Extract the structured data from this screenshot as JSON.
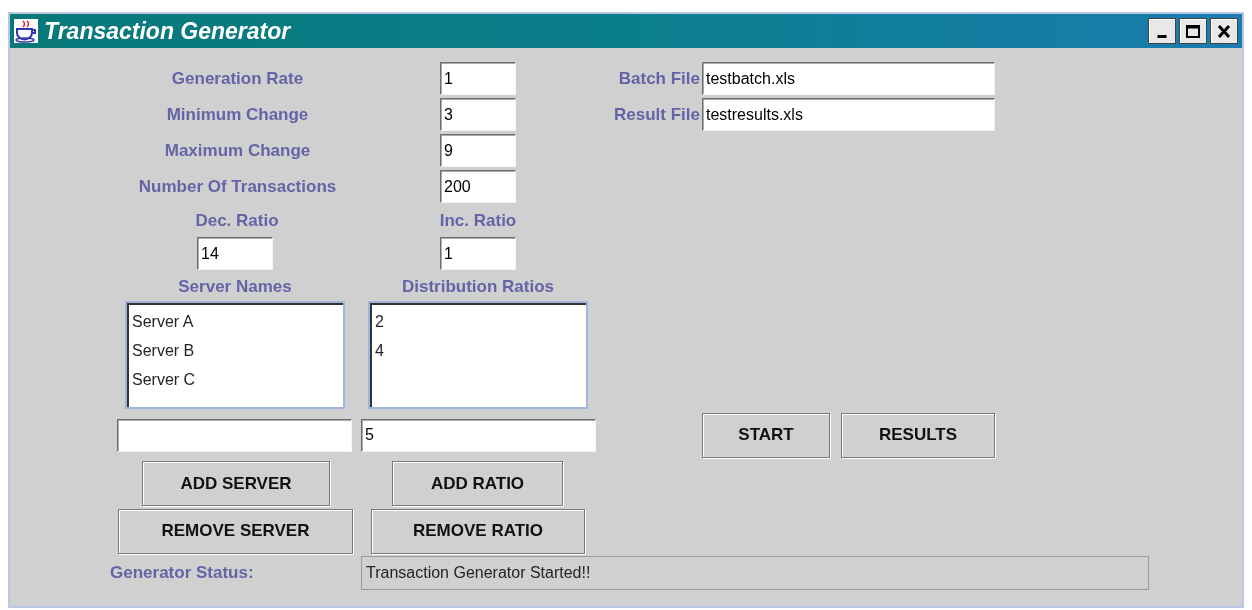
{
  "window": {
    "title": "Transaction Generator"
  },
  "settings": [
    {
      "label": "Generation Rate",
      "value": "1"
    },
    {
      "label": "Minimum Change",
      "value": "3"
    },
    {
      "label": "Maximum Change",
      "value": "9"
    },
    {
      "label": "Number Of Transactions",
      "value": "200"
    }
  ],
  "files": [
    {
      "label": "Batch File",
      "value": "testbatch.xls"
    },
    {
      "label": "Result File",
      "value": "testresults.xls"
    }
  ],
  "ratios": [
    {
      "label": "Dec. Ratio",
      "value": "14"
    },
    {
      "label": "Inc. Ratio",
      "value": "1"
    }
  ],
  "lists": [
    {
      "heading": "Server Names",
      "items": [
        "Server A",
        "Server B",
        "Server C"
      ],
      "add_button": "ADD SERVER",
      "remove_button": "REMOVE SERVER"
    },
    {
      "heading": "Distribution Ratios",
      "items": [
        "2",
        "4"
      ],
      "entry": "5",
      "add_button": "ADD RATIO",
      "remove_button": "REMOVE RATIO"
    }
  ],
  "actions": [
    "START",
    "RESULTS"
  ],
  "status": {
    "label": "Generator Status:",
    "value": "Transaction Generator Started!!"
  }
}
